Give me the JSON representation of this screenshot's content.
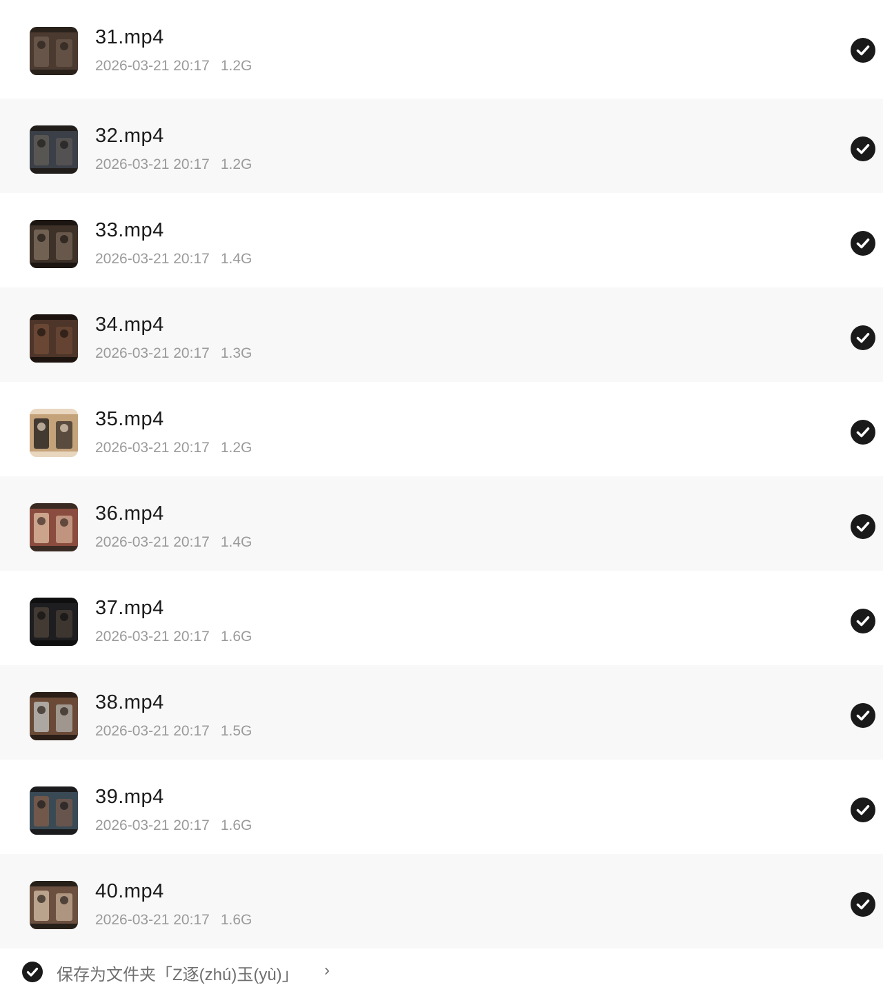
{
  "files": [
    {
      "name": "31.mp4",
      "date": "2026-03-21 20:17",
      "size": "1.2G",
      "selected": true,
      "thumb": "thumbnail-two-people-talking",
      "colors": [
        "#4a3a30",
        "#6b5a4c",
        "#2a211b"
      ]
    },
    {
      "name": "32.mp4",
      "date": "2026-03-21 20:17",
      "size": "1.2G",
      "selected": true,
      "thumb": "thumbnail-group-of-people",
      "colors": [
        "#3b3f47",
        "#5e5a56",
        "#201d1b"
      ]
    },
    {
      "name": "33.mp4",
      "date": "2026-03-21 20:17",
      "size": "1.4G",
      "selected": true,
      "thumb": "thumbnail-interior-hall",
      "colors": [
        "#3d3128",
        "#7a6a5a",
        "#1c1612"
      ]
    },
    {
      "name": "34.mp4",
      "date": "2026-03-21 20:17",
      "size": "1.3G",
      "selected": true,
      "thumb": "thumbnail-dark-room",
      "colors": [
        "#4e3529",
        "#6e4a36",
        "#1d1410"
      ]
    },
    {
      "name": "35.mp4",
      "date": "2026-03-21 20:17",
      "size": "1.2G",
      "selected": true,
      "thumb": "thumbnail-close-up-portrait",
      "colors": [
        "#c4a27a",
        "#2c2724",
        "#e8d6bf"
      ]
    },
    {
      "name": "36.mp4",
      "date": "2026-03-21 20:17",
      "size": "1.4G",
      "selected": true,
      "thumb": "thumbnail-colorful-scene",
      "colors": [
        "#8a4c3e",
        "#d7b49a",
        "#3a2a24"
      ]
    },
    {
      "name": "37.mp4",
      "date": "2026-03-21 20:17",
      "size": "1.6G",
      "selected": true,
      "thumb": "thumbnail-night-scene",
      "colors": [
        "#1e1e20",
        "#4a4038",
        "#0f0f10"
      ]
    },
    {
      "name": "38.mp4",
      "date": "2026-03-21 20:17",
      "size": "1.5G",
      "selected": true,
      "thumb": "thumbnail-doorway",
      "colors": [
        "#6a4a36",
        "#b7b7b4",
        "#2a1e17"
      ]
    },
    {
      "name": "39.mp4",
      "date": "2026-03-21 20:17",
      "size": "1.6G",
      "selected": true,
      "thumb": "thumbnail-two-characters",
      "colors": [
        "#3a4a55",
        "#7b5a4a",
        "#1b1b1d"
      ]
    },
    {
      "name": "40.mp4",
      "date": "2026-03-21 20:17",
      "size": "1.6G",
      "selected": true,
      "thumb": "thumbnail-crowd-scene",
      "colors": [
        "#6b4f3f",
        "#c9b39b",
        "#262019"
      ]
    }
  ],
  "footer": {
    "label": "保存为文件夹「Z逐(zhú)玉(yù)」",
    "chevron": "›",
    "selected": true
  },
  "colors": {
    "check_bg": "#1a1a1a",
    "name_text": "#1b1b1b",
    "meta_text": "#9a9a9a",
    "row_alt_bg": "#f8f8f8"
  }
}
